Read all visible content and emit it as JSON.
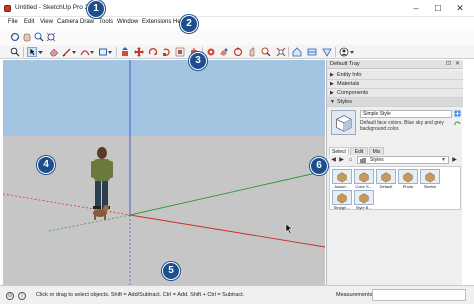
{
  "window": {
    "title": "Untitled - SketchUp Pro 2023",
    "controls": [
      "–",
      "☐",
      "✕"
    ]
  },
  "menu": [
    "File",
    "Edit",
    "View",
    "Camera",
    "Draw",
    "Tools",
    "Window",
    "Extensions",
    "Help"
  ],
  "callouts": [
    "1",
    "2",
    "3",
    "4",
    "5",
    "6"
  ],
  "toolbar_top_icons": [
    "orbit-icon",
    "pan-icon",
    "zoom-icon",
    "zoom-extents-icon"
  ],
  "toolbar_icons": [
    "search-icon",
    "select-arrow-icon",
    "select-dropdown-icon",
    "eraser-icon",
    "paint-bucket-icon",
    "pencil-line-icon",
    "arc-icon",
    "rectangle-icon",
    "push-pull-icon",
    "move-icon",
    "rotate-icon",
    "scale-icon",
    "offset-icon",
    "tape-measure-icon",
    "text-icon",
    "paint-icon",
    "orbit-icon",
    "pan-icon",
    "zoom-icon",
    "zoom-extents-icon",
    "warehouse-icon",
    "extension-warehouse-icon",
    "layout-icon",
    "account-icon"
  ],
  "viewport": {
    "sky_color": "#a3c5e1",
    "ground_color": "#c6c6c6",
    "axis_colors": {
      "red": "#d12a2a",
      "green": "#2f9a3a",
      "blue": "#3a54c9"
    }
  },
  "tray": {
    "title": "Default Tray",
    "controls": [
      "⊡",
      "✕"
    ],
    "sections": [
      {
        "label": "Entity Info",
        "open": false
      },
      {
        "label": "Materials",
        "open": false
      },
      {
        "label": "Components",
        "open": false
      },
      {
        "label": "Styles",
        "open": true
      }
    ],
    "style": {
      "name": "Simple Style",
      "description": "Default face colors. Blue sky and grey background color."
    },
    "tabs": [
      "Select",
      "Edit",
      "Mix"
    ],
    "active_tab": "Select",
    "collection": "Styles",
    "thumbnails": [
      "Assort…",
      "Color S…",
      "Default",
      "Photo",
      "Sketch",
      "Straigh…",
      "Style B…"
    ]
  },
  "status": {
    "text": "Click or drag to select objects. Shift = Add/Subtract. Ctrl = Add. Shift + Ctrl = Subtract.",
    "measurements_label": "Measurements",
    "measurements_value": ""
  }
}
